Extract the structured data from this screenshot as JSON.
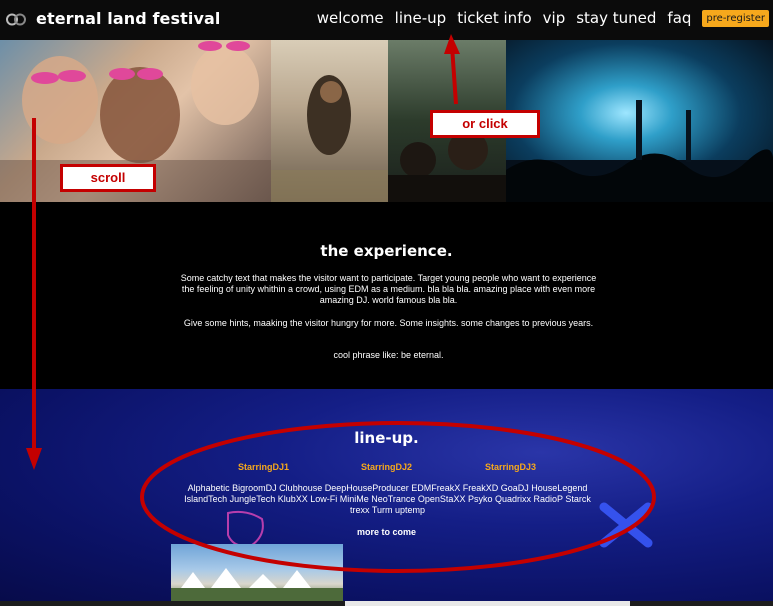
{
  "header": {
    "brand": "eternal land festival",
    "nav": [
      "welcome",
      "line-up",
      "ticket info",
      "vip",
      "stay tuned",
      "faq"
    ],
    "cta": "pre-register",
    "cta_color": "#f6a81c"
  },
  "experience": {
    "title": "the experience.",
    "p1": "Some catchy text that makes the visitor want to participate. Target young people who want to experience the feeling of unity whithin a crowd, using EDM as a medium. bla bla bla. amazing place with even more amazing DJ. world famous bla bla.",
    "p2": "Give some hints, maaking the visitor hungry for more. Some insights. some changes to previous years.",
    "p3": "cool phrase like: be eternal."
  },
  "lineup": {
    "title": "line-up.",
    "headliners": [
      "StarringDJ1",
      "StarringDJ2",
      "StarringDJ3"
    ],
    "artists": "Alphabetic BigroomDJ Clubhouse DeepHouseProducer EDMFreakX FreakXD GoaDJ HouseLegend IslandTech JungleTech KlubXX Low-Fi MiniMe NeoTrance OpenStaXX Psyko Quadrixx RadioP Starck trexx Turm uptemp",
    "more": "more to come",
    "accent_color": "#f6a81c"
  },
  "annotations": {
    "scroll": "scroll",
    "click": "or click",
    "color": "#c40000"
  }
}
